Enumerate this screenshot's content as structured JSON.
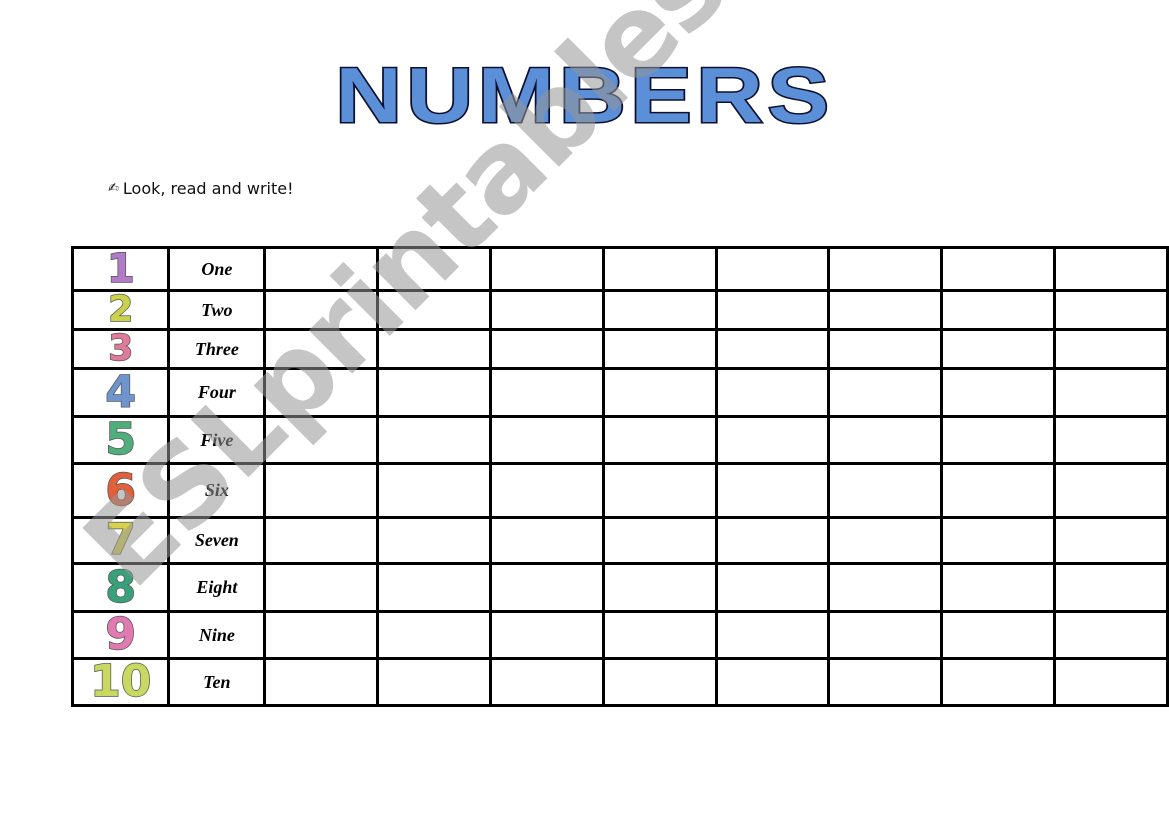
{
  "title": "NUMBERS",
  "instruction": {
    "icon": "writing-hand-icon",
    "glyph": "✍",
    "text": "Look, read and write!"
  },
  "rows": [
    {
      "digit": "1",
      "word": "One",
      "color": "#b07cc6"
    },
    {
      "digit": "2",
      "word": "Two",
      "color": "#c9d24a"
    },
    {
      "digit": "3",
      "word": "Three",
      "color": "#e07a9a"
    },
    {
      "digit": "4",
      "word": "Four",
      "color": "#6f95cf"
    },
    {
      "digit": "5",
      "word": "Five",
      "color": "#4fae7c"
    },
    {
      "digit": "6",
      "word": "Six",
      "color": "#e0603c"
    },
    {
      "digit": "7",
      "word": "Seven",
      "color": "#d8d24a"
    },
    {
      "digit": "8",
      "word": "Eight",
      "color": "#3aa07a"
    },
    {
      "digit": "9",
      "word": "Nine",
      "color": "#e07ab0"
    },
    {
      "digit": "10",
      "word": "Ten",
      "color": "#c8d860"
    }
  ],
  "blank_columns": 8,
  "watermark": "ESLprintables.com"
}
